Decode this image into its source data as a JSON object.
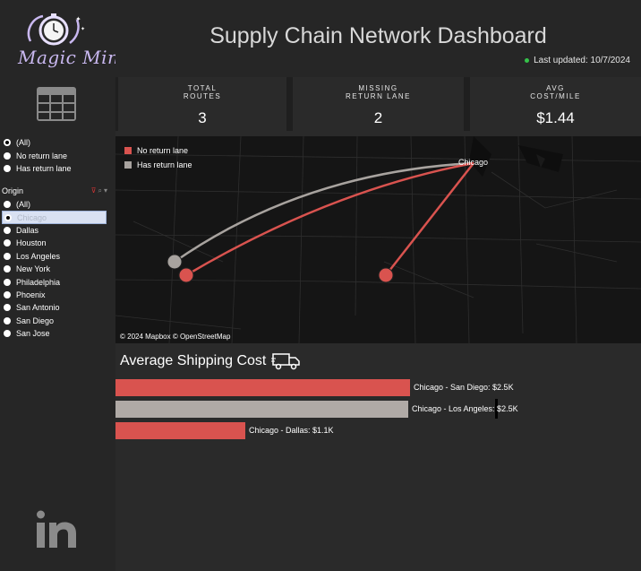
{
  "brand": {
    "logo_text": "Magic Mins"
  },
  "header": {
    "title": "Supply Chain Network Dashboard",
    "last_updated": "Last updated: 10/7/2024",
    "status_color": "#35c24a"
  },
  "kpis": [
    {
      "label_line1": "TOTAL",
      "label_line2": "ROUTES",
      "value": "3"
    },
    {
      "label_line1": "MISSING",
      "label_line2": "RETURN LANE",
      "value": "2"
    },
    {
      "label_line1": "AVG",
      "label_line2": "COST/MILE",
      "value": "$1.44"
    }
  ],
  "filters": {
    "return_lane": {
      "options": [
        "(All)",
        "No return lane",
        "Has return lane"
      ],
      "selected": "(All)"
    },
    "origin": {
      "title": "Origin",
      "options": [
        "(All)",
        "Chicago",
        "Dallas",
        "Houston",
        "Los Angeles",
        "New York",
        "Philadelphia",
        "Phoenix",
        "San Antonio",
        "San Diego",
        "San Jose"
      ],
      "selected": "Chicago"
    }
  },
  "map": {
    "legend": [
      {
        "label": "No return lane",
        "color": "#d9534f"
      },
      {
        "label": "Has return lane",
        "color": "#a8a39f"
      }
    ],
    "city_label": "Chicago",
    "attribution": "© 2024 Mapbox  © OpenStreetMap"
  },
  "cost_section": {
    "title": "Average Shipping Cost",
    "icon": "truck-icon",
    "bars": [
      {
        "label": "Chicago  -  San Diego: $2.5K",
        "value": 2.5,
        "color": "#d9534f"
      },
      {
        "label": "Chicago  -  Los Angeles: $2.5K",
        "value": 2.5,
        "color": "#b0aaa6"
      },
      {
        "label": "Chicago  -  Dallas: $1.1K",
        "value": 1.1,
        "color": "#d9534f"
      }
    ]
  },
  "footer": {
    "icon": "linkedin-icon"
  }
}
